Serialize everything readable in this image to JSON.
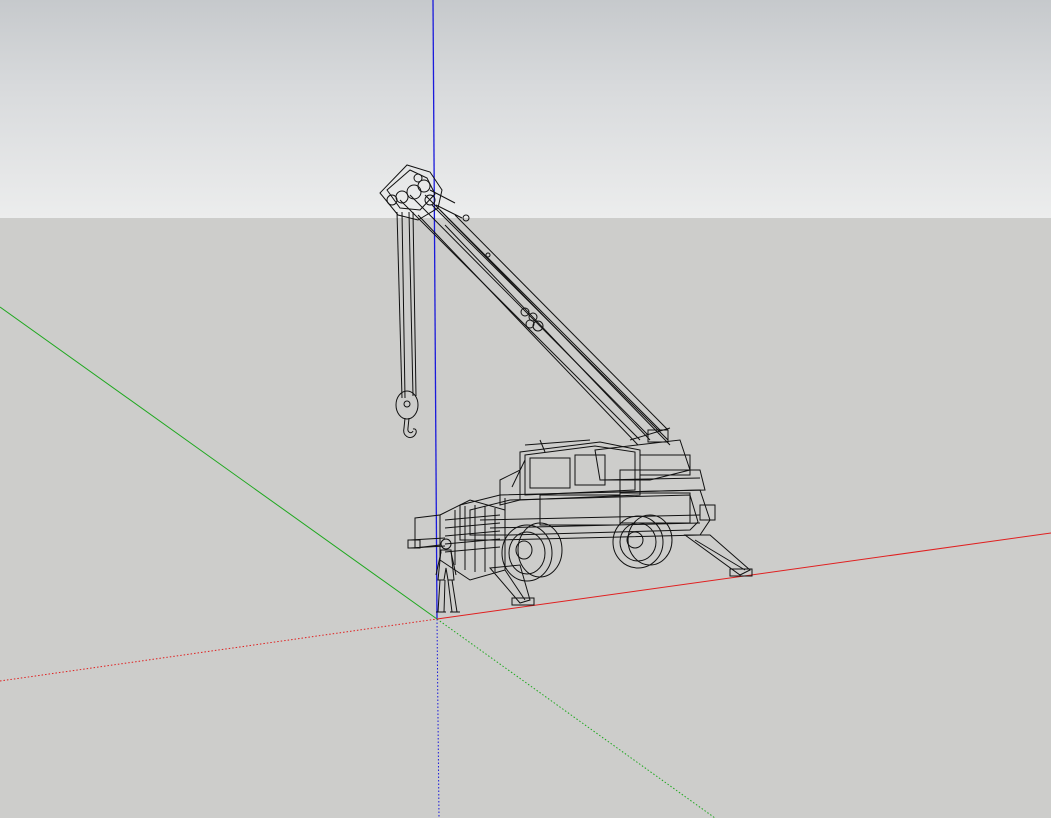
{
  "viewport": {
    "sky_color": "#e9eaea",
    "ground_color": "#cdcdcb"
  },
  "axes": {
    "red": "#e02020",
    "green": "#1fa81f",
    "blue": "#1a1adb"
  },
  "model": {
    "name": "crane-truck",
    "render_style": "wireframe",
    "edge_color": "#111111"
  }
}
